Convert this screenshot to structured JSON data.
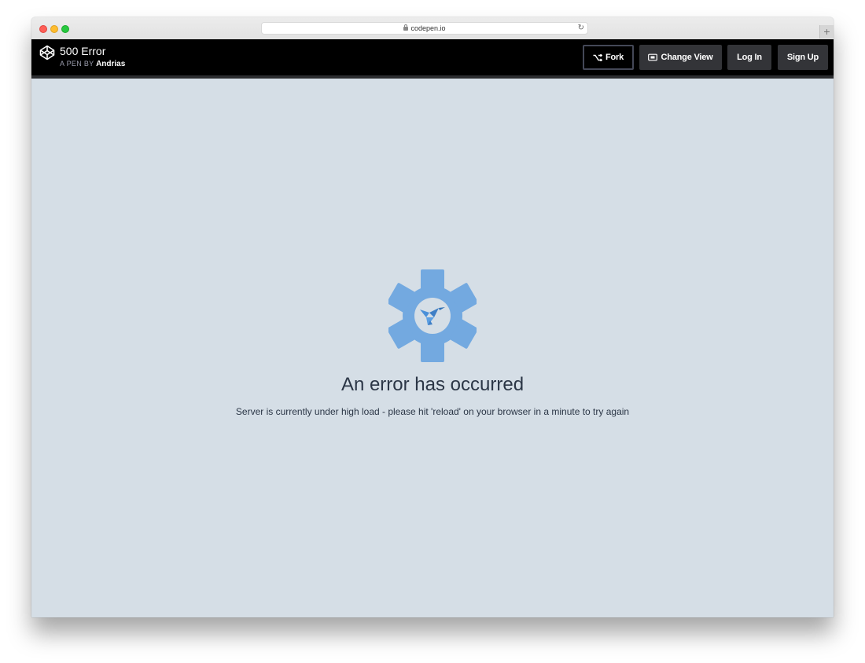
{
  "browser": {
    "address": "codepen.io",
    "new_tab_glyph": "+",
    "reload_glyph": "↻"
  },
  "header": {
    "pen_title": "500 Error",
    "pen_by_label": "A PEN BY",
    "author": "Andrias",
    "buttons": {
      "fork": "Fork",
      "change_view": "Change View",
      "log_in": "Log In",
      "sign_up": "Sign Up"
    }
  },
  "main": {
    "error_title": "An error has occurred",
    "error_message": "Server is currently under high load - please hit 'reload' on your browser in a minute to try again"
  },
  "icons": {
    "logo": "codepen-logo-icon",
    "fork": "fork-icon",
    "change_view": "change-view-icon",
    "gear": "gear-icon",
    "bird": "hummingbird-icon"
  },
  "colors": {
    "header_bg": "#000000",
    "button_bg": "#333438",
    "content_bg": "#d5dee6",
    "gear": "#73a9e0",
    "bird": "#4a90d9",
    "text": "#2b3646"
  }
}
